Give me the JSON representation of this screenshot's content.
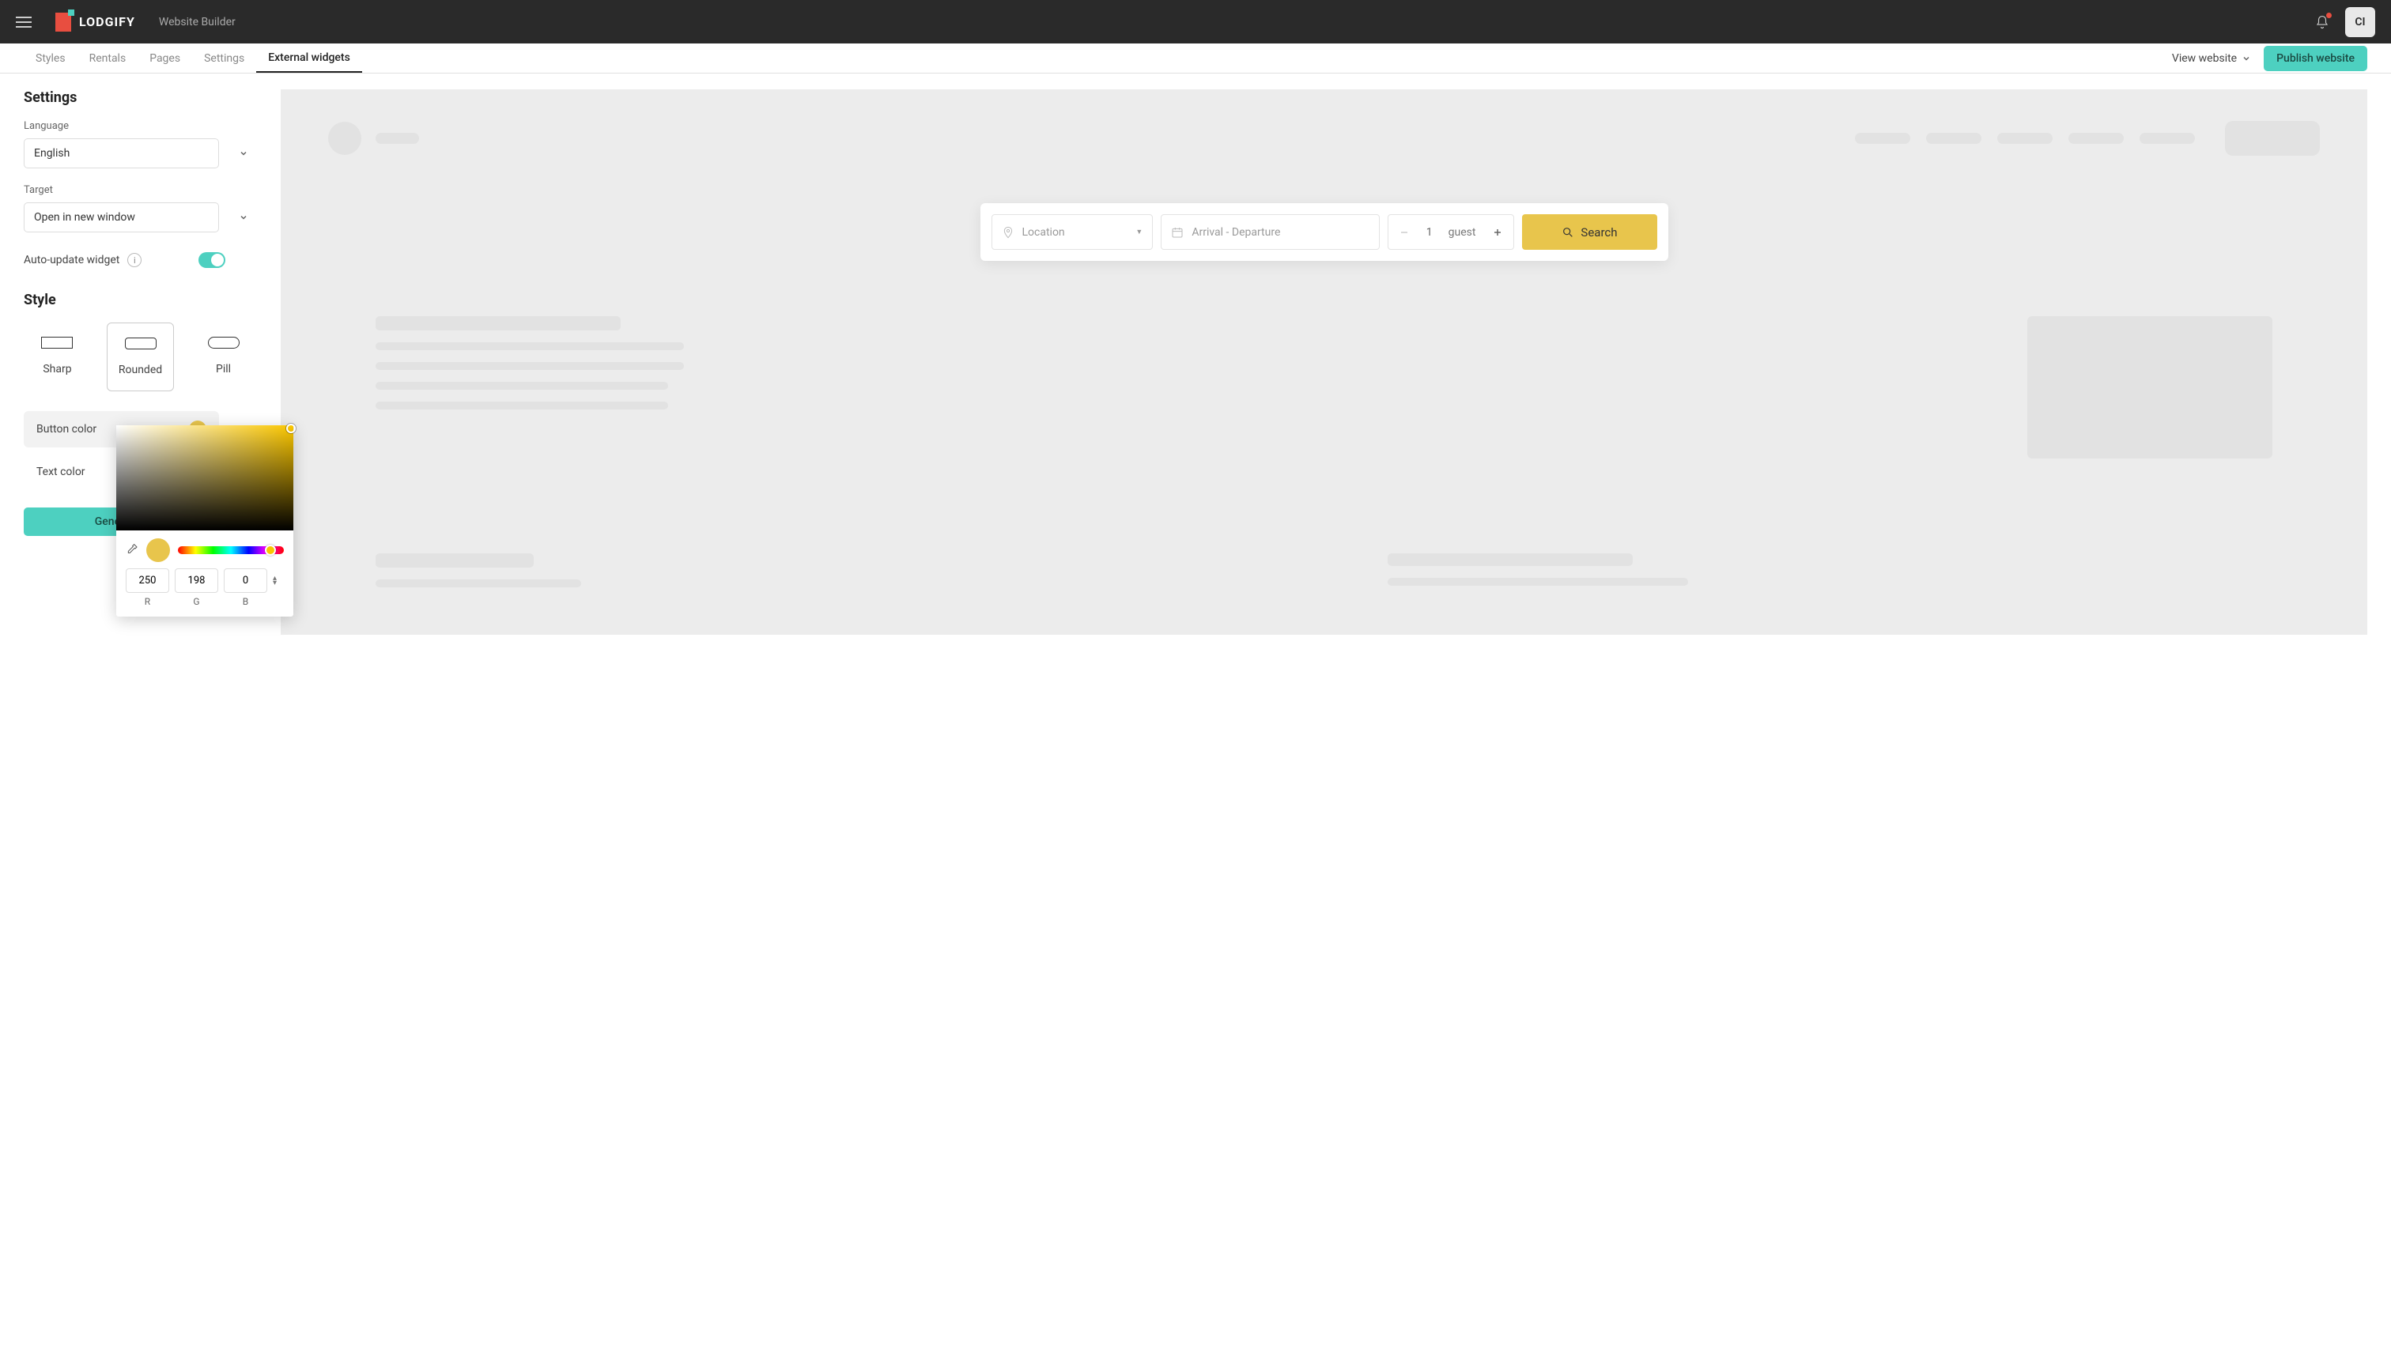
{
  "header": {
    "logo_text": "LODGIFY",
    "breadcrumb": "Website Builder",
    "avatar_initials": "CI"
  },
  "tabs": {
    "items": [
      {
        "label": "Styles"
      },
      {
        "label": "Rentals"
      },
      {
        "label": "Pages"
      },
      {
        "label": "Settings"
      },
      {
        "label": "External widgets",
        "active": true
      }
    ],
    "view_label": "View website",
    "publish_label": "Publish website"
  },
  "settings": {
    "title": "Settings",
    "language_label": "Language",
    "language_value": "English",
    "target_label": "Target",
    "target_value": "Open in new window",
    "auto_update_label": "Auto-update widget",
    "auto_update_on": true
  },
  "style": {
    "title": "Style",
    "shapes": [
      {
        "name": "Sharp"
      },
      {
        "name": "Rounded",
        "selected": true
      },
      {
        "name": "Pill"
      }
    ],
    "button_color_label": "Button color",
    "button_color_hex": "#e8c54c",
    "text_color_label": "Text color",
    "text_color_hex": "#333333",
    "generate_label": "Generate c"
  },
  "color_picker": {
    "swatch_hex": "#e8c54c",
    "r": "250",
    "g": "198",
    "b": "0",
    "labels": {
      "r": "R",
      "g": "G",
      "b": "B"
    }
  },
  "preview": {
    "search": {
      "location_placeholder": "Location",
      "dates_placeholder": "Arrival - Departure",
      "guest_count": "1",
      "guest_label": "guest",
      "search_label": "Search"
    }
  },
  "colors": {
    "accent": "#4dd0c0",
    "brand_red": "#e84e40"
  }
}
